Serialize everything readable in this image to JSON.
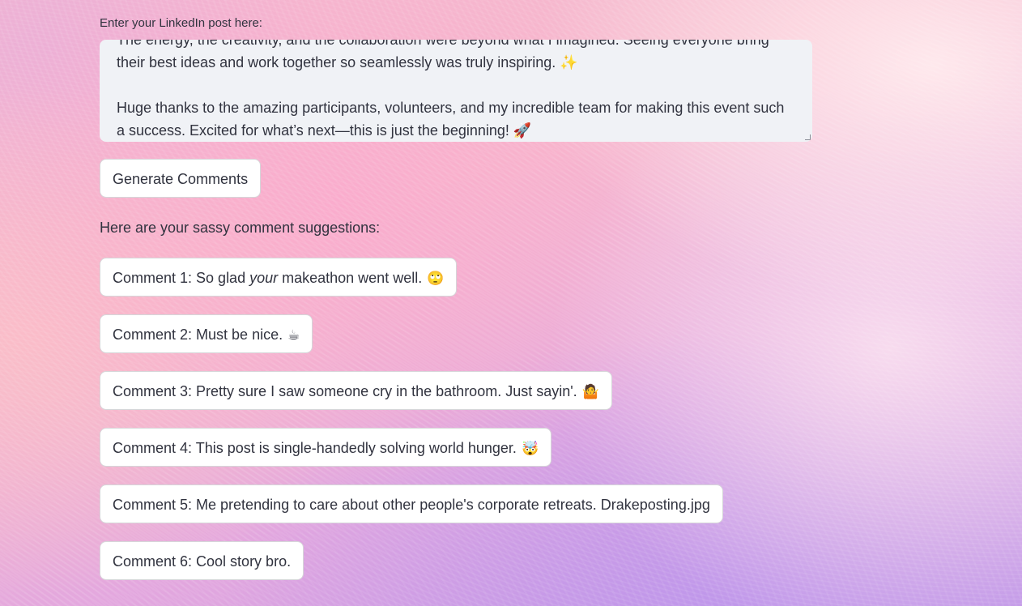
{
  "input": {
    "label": "Enter your LinkedIn post here:",
    "value": "The energy, the creativity, and the collaboration were beyond what I imagined. Seeing everyone bring their best ideas and work together so seamlessly was truly inspiring. ✨\n\nHuge thanks to the amazing participants, volunteers, and my incredible team for making this event such a success. Excited for what’s next—this is just the beginning! 🚀"
  },
  "generate_button": {
    "label": "Generate Comments"
  },
  "results": {
    "heading": "Here are your sassy comment suggestions:",
    "comments": [
      {
        "prefix": "Comment 1: So glad ",
        "emphasis": "your",
        "suffix": " makeathon went well.",
        "emoji": "🙄"
      },
      {
        "prefix": "Comment 2: Must be nice.",
        "emphasis": "",
        "suffix": "",
        "emoji": "☕"
      },
      {
        "prefix": "Comment 3: Pretty sure I saw someone cry in the bathroom. Just sayin'.",
        "emphasis": "",
        "suffix": "",
        "emoji": "🤷"
      },
      {
        "prefix": "Comment 4: This post is single-handedly solving world hunger.",
        "emphasis": "",
        "suffix": "",
        "emoji": "🤯"
      },
      {
        "prefix": "Comment 5: Me pretending to care about other people's corporate retreats. Drakeposting.jpg",
        "emphasis": "",
        "suffix": "",
        "emoji": ""
      },
      {
        "prefix": "Comment 6: Cool story bro.",
        "emphasis": "",
        "suffix": "",
        "emoji": ""
      }
    ]
  }
}
